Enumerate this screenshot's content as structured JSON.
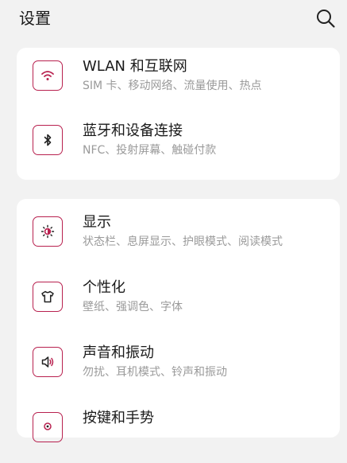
{
  "header": {
    "title": "设置",
    "search_icon": "search-icon"
  },
  "accent_color": "#b8214f",
  "groups": [
    {
      "items": [
        {
          "title": "WLAN 和互联网",
          "subtitle": "SIM 卡、移动网络、流量使用、热点",
          "icon": "wifi-icon"
        },
        {
          "title": "蓝牙和设备连接",
          "subtitle": "NFC、投射屏幕、触碰付款",
          "icon": "bluetooth-icon"
        }
      ]
    },
    {
      "items": [
        {
          "title": "显示",
          "subtitle": "状态栏、息屏显示、护眼模式、阅读模式",
          "icon": "brightness-icon"
        },
        {
          "title": "个性化",
          "subtitle": "壁纸、强调色、字体",
          "icon": "tshirt-icon"
        },
        {
          "title": "声音和振动",
          "subtitle": "勿扰、耳机模式、铃声和振动",
          "icon": "speaker-icon"
        },
        {
          "title": "按键和手势",
          "subtitle": "",
          "icon": "gesture-icon"
        }
      ]
    }
  ]
}
